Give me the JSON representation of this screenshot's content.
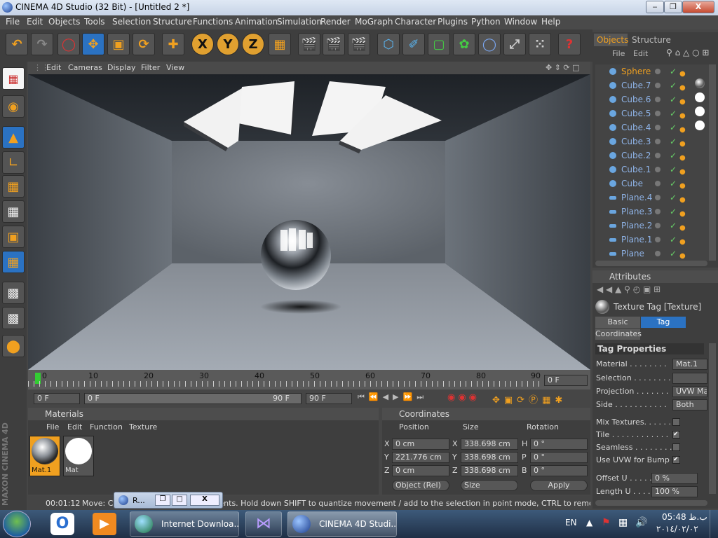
{
  "window": {
    "title": "CINEMA 4D Studio (32 Bit) - [Untitled 2 *]",
    "min_label": "‒",
    "max_label": "❐",
    "close_label": "X"
  },
  "menu": [
    "File",
    "Edit",
    "Objects",
    "Tools",
    "Selection",
    "Structure",
    "Functions",
    "Animation",
    "Simulation",
    "Render",
    "MoGraph",
    "Character",
    "Plugins",
    "Python",
    "Window",
    "Help"
  ],
  "toolbar": {
    "x_label": "X",
    "y_label": "Y",
    "z_label": "Z"
  },
  "viewport": {
    "menu": [
      "Edit",
      "Cameras",
      "Display",
      "Filter",
      "View"
    ]
  },
  "timeline": {
    "ticks": [
      "0",
      "10",
      "20",
      "30",
      "40",
      "50",
      "60",
      "70",
      "80",
      "90"
    ],
    "frame_display": "0 F",
    "start_field": "0 F",
    "range_start": "0 F",
    "range_end": "90 F",
    "end_field": "90 F"
  },
  "materials": {
    "title": "Materials",
    "menu": [
      "File",
      "Edit",
      "Function",
      "Texture"
    ],
    "items": [
      {
        "label": "Mat.1"
      },
      {
        "label": "Mat"
      }
    ]
  },
  "coordinates": {
    "title": "Coordinates",
    "headers": [
      "Position",
      "Size",
      "Rotation"
    ],
    "rows": [
      {
        "axis": "X",
        "pos": "0 cm",
        "size_axis": "X",
        "size": "338.698 cm",
        "rot_axis": "H",
        "rot": "0 °"
      },
      {
        "axis": "Y",
        "pos": "221.776 cm",
        "size_axis": "Y",
        "size": "338.698 cm",
        "rot_axis": "P",
        "rot": "0 °"
      },
      {
        "axis": "Z",
        "pos": "0 cm",
        "size_axis": "Z",
        "size": "338.698 cm",
        "rot_axis": "B",
        "rot": "0 °"
      }
    ],
    "mode_select": "Object (Rel)",
    "size_select": "Size",
    "apply_label": "Apply"
  },
  "objects_panel": {
    "tabs": [
      "Objects",
      "Structure"
    ],
    "menu": [
      "File",
      "Edit"
    ],
    "items": [
      "Sphere",
      "Cube.7",
      "Cube.6",
      "Cube.5",
      "Cube.4",
      "Cube.3",
      "Cube.2",
      "Cube.1",
      "Cube",
      "Plane.4",
      "Plane.3",
      "Plane.2",
      "Plane.1",
      "Plane"
    ]
  },
  "attributes": {
    "title": "Attributes",
    "subtitle": "Texture Tag [Texture]",
    "tabs": [
      "Basic",
      "Tag",
      "Coordinates"
    ],
    "section": "Tag Properties",
    "material_label": "Material . . . . . . . .",
    "material_value": "Mat.1",
    "selection_label": "Selection . . . . . . . .",
    "projection_label": "Projection . . . . . . .",
    "projection_value": "UVW Ma",
    "side_label": "Side . . . . . . . . . . .",
    "side_value": "Both",
    "mix_label": "Mix Textures. . . . . . .",
    "tile_label": "Tile . . . . . . . . . . . .",
    "seamless_label": "Seamless . . . . . . . .",
    "uvwbump_label": "Use UVW for Bump",
    "offsetu_label": "Offset U . . . . .",
    "offsetu_value": "0 %",
    "lengthu_label": "Length U . . . . .",
    "lengthu_value": "100 %",
    "check_mark": "✔"
  },
  "status": {
    "time": "00:01:12",
    "message": "Move: Click and drag to move elements. Hold down SHIFT to quantize movement / add to the selection in point mode, CTRL to remove.",
    "popup_label": "R...",
    "popup_close": "X"
  },
  "brand": "MAXON CINEMA 4D",
  "taskbar": {
    "items": [
      "Internet Downloa...",
      "CINEMA 4D Studi..."
    ],
    "lang": "EN",
    "time": "05:48 ب.ظ",
    "date": "٢٠١٤/٠٢/٠٢"
  }
}
